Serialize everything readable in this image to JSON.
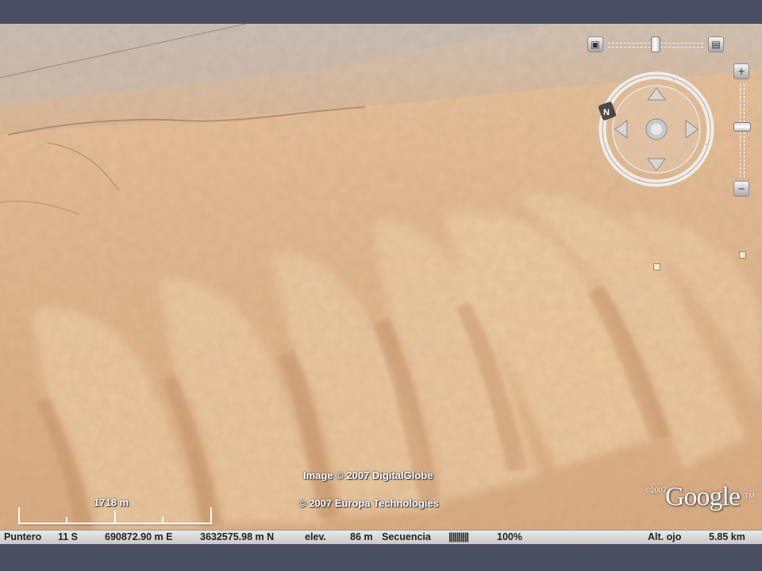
{
  "credits": {
    "image": "Image © 2007 DigitalGlobe",
    "europa": "© 2007 Europa Technologies",
    "google_copyright": "©2007",
    "google_logo": "Google",
    "google_tm": "TM"
  },
  "scale": {
    "label": "1718 m"
  },
  "compass": {
    "north_label": "N"
  },
  "zoom": {
    "in_label": "+",
    "out_label": "−"
  },
  "status": {
    "pointer_label": "Puntero",
    "zone": "11 S",
    "easting": "690872.90 m E",
    "northing": "3632575.98 m N",
    "elev_label": "elev.",
    "elev_value": "86 m",
    "stream_label": "Secuencia",
    "stream_bars": "||||||||||",
    "stream_percent": "100%",
    "eye_label": "Alt. ojo",
    "eye_value": "5.85 km"
  },
  "colors": {
    "sand": "#e2b88d",
    "frame": "#4b4f63",
    "status_bg": "#d8d8d8"
  }
}
